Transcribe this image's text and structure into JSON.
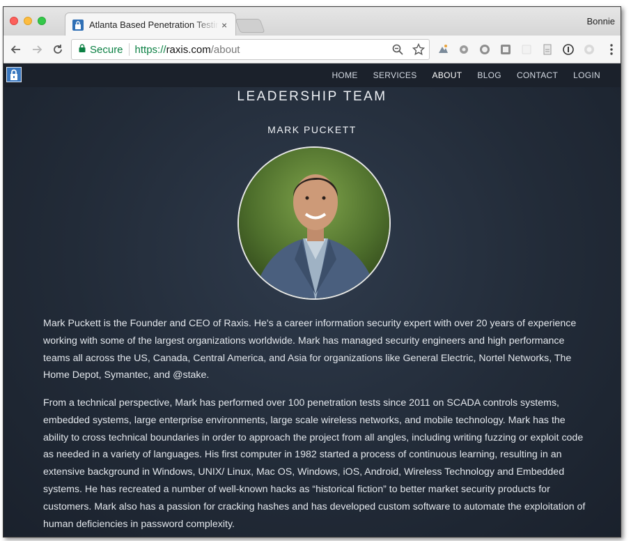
{
  "browser": {
    "tab_title": "Atlanta Based Penetration Testing",
    "tab_close": "×",
    "profile_name": "Bonnie",
    "secure_label": "Secure",
    "url_scheme": "https://",
    "url_host": "raxis.com",
    "url_path": "/about"
  },
  "site": {
    "nav": [
      "HOME",
      "SERVICES",
      "ABOUT",
      "BLOG",
      "CONTACT",
      "LOGIN"
    ],
    "active_nav": "ABOUT"
  },
  "main": {
    "section_title": "LEADERSHIP TEAM",
    "person_name": "MARK PUCKETT",
    "bio": [
      "Mark Puckett is the Founder and CEO of Raxis. He's a career information security expert with over 20 years of experience working with some of the largest organizations worldwide. Mark has managed security engineers and high performance teams all across the US, Canada, Central America, and Asia for organizations like General Electric, Nortel Networks, The Home Depot, Symantec, and @stake.",
      "From a technical perspective, Mark has performed over 100 penetration tests since 2011 on SCADA controls systems, embedded systems, large enterprise environments, large scale wireless networks, and mobile technology. Mark has the ability to cross technical boundaries in order to approach the project from all angles, including writing fuzzing or exploit code as needed in a variety of languages. His first computer in 1982 started a process of continuous learning, resulting in an extensive background in Windows, UNIX/ Linux, Mac OS, Windows, iOS, Android, Wireless Technology and Embedded systems. He has recreated a number of well-known hacks as “historical fiction” to better market security products for customers. Mark also has a passion for cracking hashes and has developed custom software to automate the exploitation of human deficiencies in password complexity."
    ]
  },
  "icons": [
    "back-icon",
    "forward-icon",
    "reload-icon",
    "lock-icon",
    "zoom-icon",
    "star-icon",
    "extension-icon",
    "menu-icon"
  ],
  "colors": {
    "page_bg": "#242d3a",
    "nav_bg": "#1b212b",
    "secure_green": "#0b8043"
  }
}
